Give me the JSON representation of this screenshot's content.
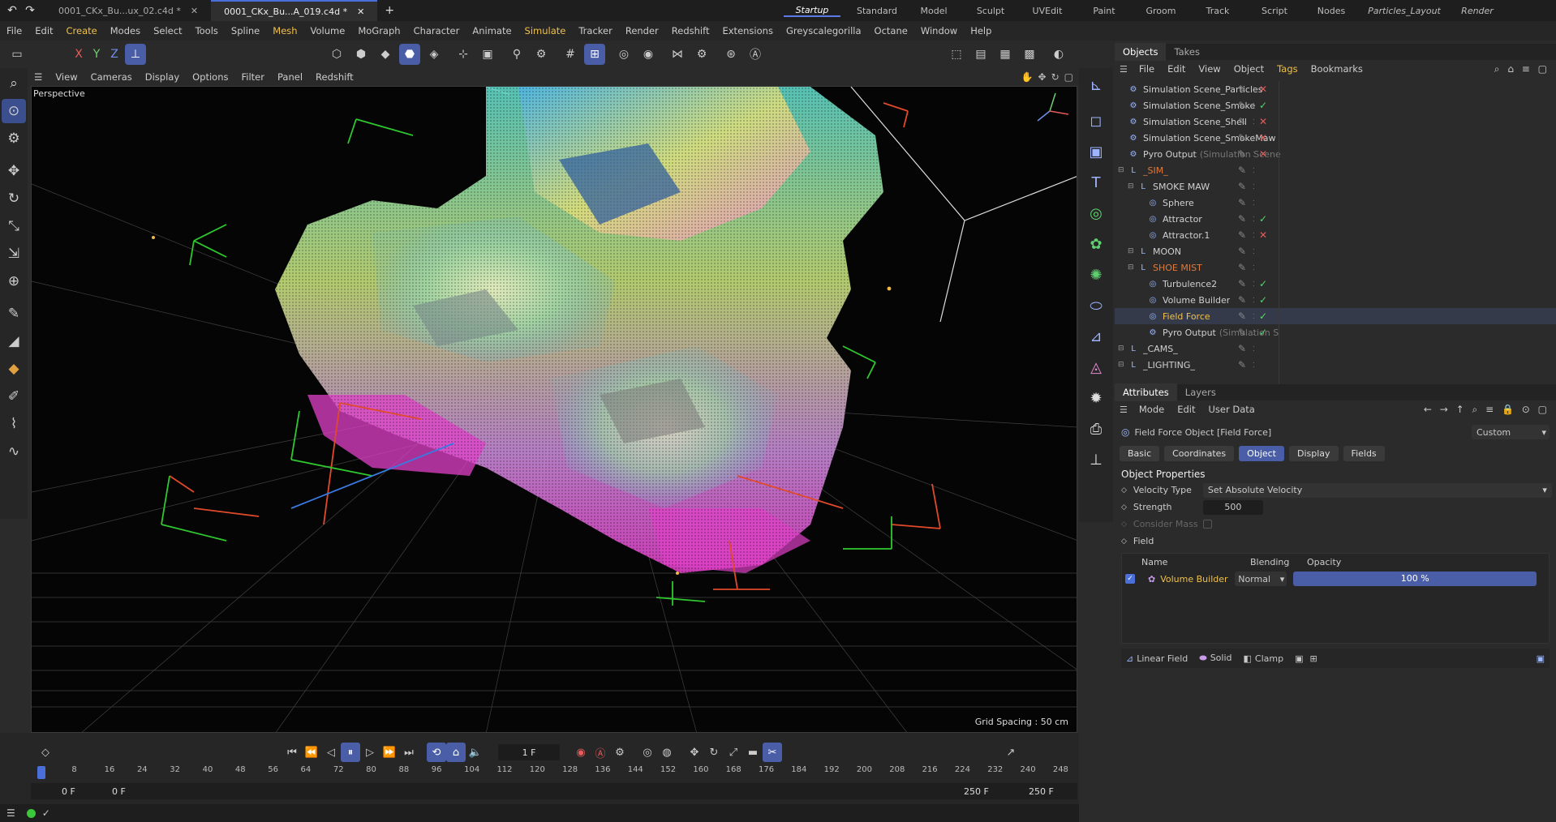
{
  "titlebar": {
    "tabs": [
      "0001_CKx_Bu...ux_02.c4d *",
      "0001_CKx_Bu...A_019.c4d *"
    ],
    "layouts": [
      "Startup",
      "Standard",
      "Model",
      "Sculpt",
      "UVEdit",
      "Paint",
      "Groom",
      "Track",
      "Script",
      "Nodes",
      "Particles_Layout",
      "Render"
    ]
  },
  "menubar": [
    "File",
    "Edit",
    "Create",
    "Modes",
    "Select",
    "Tools",
    "Spline",
    "Mesh",
    "Volume",
    "MoGraph",
    "Character",
    "Animate",
    "Simulate",
    "Tracker",
    "Render",
    "Redshift",
    "Extensions",
    "Greyscalegorilla",
    "Octane",
    "Window",
    "Help"
  ],
  "toolbar": {
    "axes": [
      "X",
      "Y",
      "Z"
    ]
  },
  "viewport": {
    "menu": [
      "View",
      "Cameras",
      "Display",
      "Options",
      "Filter",
      "Panel",
      "Redshift"
    ],
    "label": "Perspective",
    "grid_spacing": "Grid Spacing : 50 cm"
  },
  "timeline": {
    "current_frame": "1 F",
    "ticks": [
      "0",
      "8",
      "16",
      "24",
      "32",
      "40",
      "48",
      "56",
      "64",
      "72",
      "80",
      "88",
      "96",
      "104",
      "112",
      "120",
      "128",
      "136",
      "144",
      "152",
      "160",
      "168",
      "176",
      "184",
      "192",
      "200",
      "208",
      "216",
      "224",
      "232",
      "240",
      "248"
    ],
    "start_field": "0 F",
    "start_field2": "0 F",
    "end_field": "250 F",
    "end_field2": "250 F"
  },
  "objects_panel": {
    "tabs": [
      "Objects",
      "Takes"
    ],
    "menu": [
      "File",
      "Edit",
      "View",
      "Object",
      "Tags",
      "Bookmarks"
    ],
    "rows": [
      {
        "name": "Simulation Scene_Particles",
        "indent": 0,
        "status": "x"
      },
      {
        "name": "Simulation Scene_Smoke",
        "indent": 0,
        "status": "check"
      },
      {
        "name": "Simulation Scene_Shell",
        "indent": 0,
        "status": "x"
      },
      {
        "name": "Simulation Scene_SmokeMaw",
        "indent": 0,
        "status": "x"
      },
      {
        "name": "Pyro Output",
        "suffix": "(Simulation Scene",
        "indent": 0,
        "status": "x"
      },
      {
        "name": "_SIM_",
        "indent": 0,
        "status": "",
        "color": "#e07a3a"
      },
      {
        "name": "SMOKE MAW",
        "indent": 1,
        "status": ""
      },
      {
        "name": "Sphere",
        "indent": 2,
        "status": ""
      },
      {
        "name": "Attractor",
        "indent": 2,
        "status": "check"
      },
      {
        "name": "Attractor.1",
        "indent": 2,
        "status": "x"
      },
      {
        "name": "MOON",
        "indent": 1,
        "status": ""
      },
      {
        "name": "SHOE MIST",
        "indent": 1,
        "status": "",
        "color": "#e07a3a"
      },
      {
        "name": "Turbulence2",
        "indent": 2,
        "status": "check"
      },
      {
        "name": "Volume Builder",
        "indent": 2,
        "status": "check"
      },
      {
        "name": "Field Force",
        "indent": 2,
        "status": "check",
        "color": "#f0c04a"
      },
      {
        "name": "Pyro Output",
        "suffix": "(Simulation S",
        "indent": 2,
        "status": "check"
      },
      {
        "name": "_CAMS_",
        "indent": 0,
        "status": ""
      },
      {
        "name": "_LIGHTING_",
        "indent": 0,
        "status": ""
      }
    ]
  },
  "attributes": {
    "tabs": [
      "Attributes",
      "Layers"
    ],
    "menu": [
      "Mode",
      "Edit",
      "User Data"
    ],
    "object_title": "Field Force Object [Field Force]",
    "preset": "Custom",
    "sections": [
      "Basic",
      "Coordinates",
      "Object",
      "Display",
      "Fields"
    ],
    "active_section": "Object",
    "heading": "Object Properties",
    "velocity_type_label": "Velocity Type",
    "velocity_type_value": "Set Absolute Velocity",
    "strength_label": "Strength",
    "strength_value": "500",
    "consider_mass_label": "Consider Mass",
    "field_label": "Field",
    "field_table": {
      "headers": [
        "Name",
        "Blending",
        "Opacity"
      ],
      "row": {
        "name": "Volume Builder",
        "blending": "Normal",
        "opacity": "100 %",
        "opacity_fraction": 1.0
      }
    },
    "field_buttons": [
      "Linear Field",
      "Solid",
      "Clamp"
    ]
  }
}
